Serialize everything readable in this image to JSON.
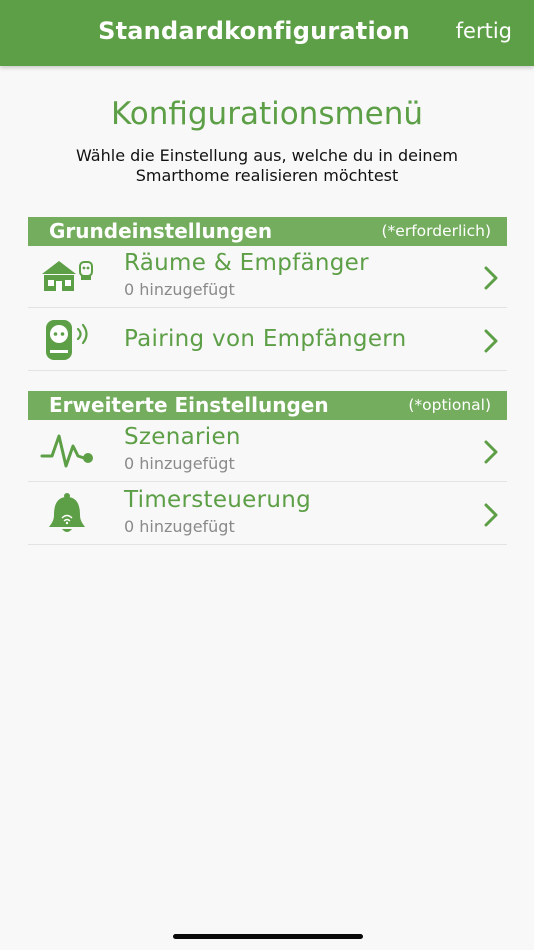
{
  "topbar": {
    "title": "Standardkonfiguration",
    "done_label": "fertig"
  },
  "heading": {
    "title": "Konfigurationsmenü",
    "subtitle_line1": "Wähle die Einstellung aus, welche du in deinem",
    "subtitle_line2": "Smarthome realisieren möchtest"
  },
  "sections": [
    {
      "title": "Grundeinstellungen",
      "note": "(*erforderlich)",
      "items": [
        {
          "icon": "house-icon",
          "title": "Räume & Empfänger",
          "subtitle": "0 hinzugefügt"
        },
        {
          "icon": "plug-pairing-icon",
          "title": "Pairing von Empfängern"
        }
      ]
    },
    {
      "title": "Erweiterte Einstellungen",
      "note": "(*optional)",
      "items": [
        {
          "icon": "scenario-pulse-icon",
          "title": "Szenarien",
          "subtitle": "0 hinzugefügt"
        },
        {
          "icon": "bell-icon",
          "title": "Timersteuerung",
          "subtitle": "0 hinzugefügt"
        }
      ]
    }
  ],
  "colors": {
    "accent": "#5d9f46",
    "section_bg": "#74ad5e",
    "background": "#f8f8f8"
  }
}
